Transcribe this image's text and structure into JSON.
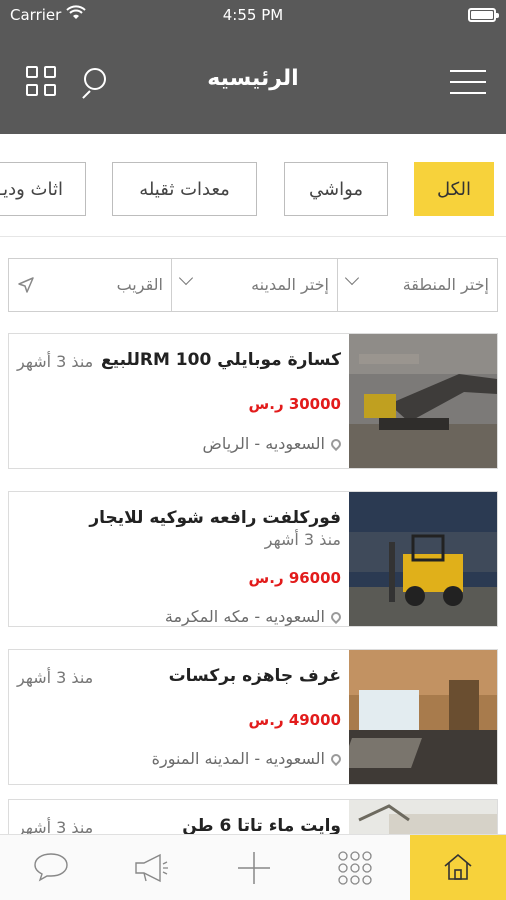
{
  "status": {
    "carrier": "Carrier",
    "time": "4:55 PM"
  },
  "nav": {
    "title": "الرئيسيه",
    "grid_icon": "grid-icon",
    "search_icon": "search-icon",
    "menu_icon": "hamburger-menu-icon"
  },
  "categories": [
    {
      "label": "الكل",
      "active": true
    },
    {
      "label": "مواشي",
      "active": false
    },
    {
      "label": "معدات ثقيله",
      "active": false
    },
    {
      "label": "اثاث وديـ",
      "active": false
    }
  ],
  "filters": {
    "region_placeholder": "إختر المنطقة",
    "city_placeholder": "إختر المدينه",
    "nearby_label": "القريب"
  },
  "listings": [
    {
      "title": "كسارة موبايلي RM 100للبيع",
      "ago": "منذ 3 أشهر",
      "price": "30000 ر.س",
      "location": "السعوديه - الرياض"
    },
    {
      "title": "فوركلفت رافعه شوكيه للايجار",
      "ago": "منذ 3 أشهر",
      "price": "96000 ر.س",
      "location": "السعوديه - مكه المكرمة"
    },
    {
      "title": "غرف جاهزه بركسات",
      "ago": "منذ 3 أشهر",
      "price": "49000 ر.س",
      "location": "السعوديه - المدينه المنورة"
    },
    {
      "title": "وايت ماء تاتا 6 طن",
      "ago": "منذ 3 أشهر",
      "price": "",
      "location": ""
    }
  ],
  "tabbar": {
    "items": [
      "home-icon",
      "apps-grid-icon",
      "add-icon",
      "megaphone-icon",
      "chat-bubble-icon"
    ],
    "accent": "#f7d23b"
  },
  "colors": {
    "header_bg": "#595959",
    "accent": "#f7d23b",
    "price": "#e21b1b"
  }
}
